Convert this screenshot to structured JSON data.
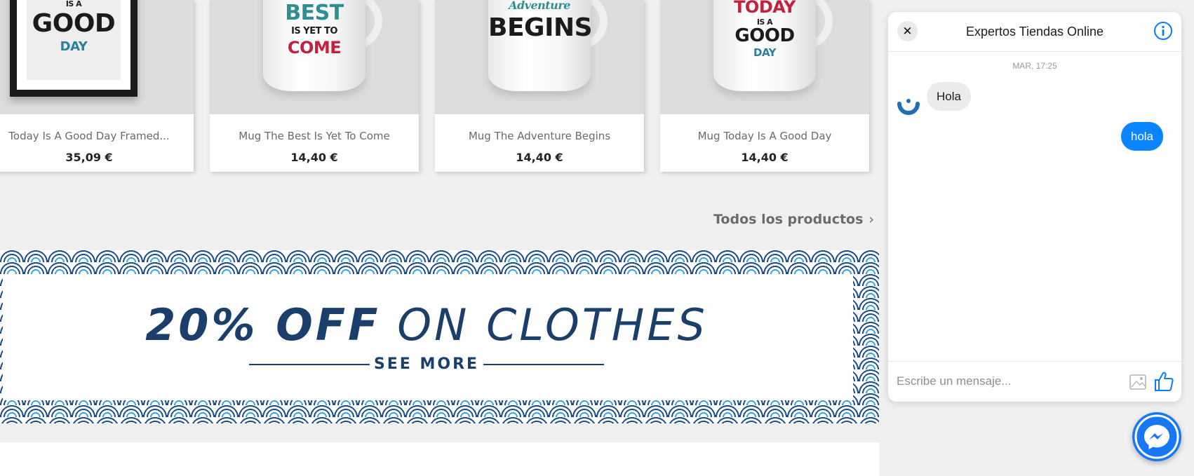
{
  "products": [
    {
      "name": "Today Is A Good Day Framed...",
      "price": "35,09 €",
      "art": {
        "line1": "IS A",
        "line2": "GOOD",
        "line3": "DAY"
      }
    },
    {
      "name": "Mug The Best Is Yet To Come",
      "price": "14,40 €",
      "art": {
        "line1": "BEST",
        "line2": "IS YET TO",
        "line3": "COME"
      }
    },
    {
      "name": "Mug The Adventure Begins",
      "price": "14,40 €",
      "art": {
        "line1": "Adventure",
        "line2": "BEGINS"
      }
    },
    {
      "name": "Mug Today Is A Good Day",
      "price": "14,40 €",
      "art": {
        "line1": "TODAY",
        "line2": "IS A",
        "line3": "GOOD",
        "line4": "DAY"
      }
    }
  ],
  "all_products_link": {
    "label": "Todos los productos",
    "icon": "chevron-right-icon"
  },
  "banner": {
    "headline_bold": "20% OFF",
    "headline_rest": "ON CLOTHES",
    "cta": "SEE MORE",
    "colors": {
      "navy": "#1b3f6b",
      "light_blue": "#3aa4d9"
    }
  },
  "chat": {
    "title": "Expertos Tiendas Online",
    "timestamp": "MAR, 17:25",
    "messages": [
      {
        "from": "page",
        "text": "Hola"
      },
      {
        "from": "user",
        "text": "hola"
      }
    ],
    "input_placeholder": "Escribe un mensaje...",
    "colors": {
      "accent": "#0a84ff",
      "bubble_in": "#ececec"
    },
    "icons": [
      "close-icon",
      "info-icon",
      "image-icon",
      "thumbs-up-icon",
      "messenger-icon"
    ]
  }
}
